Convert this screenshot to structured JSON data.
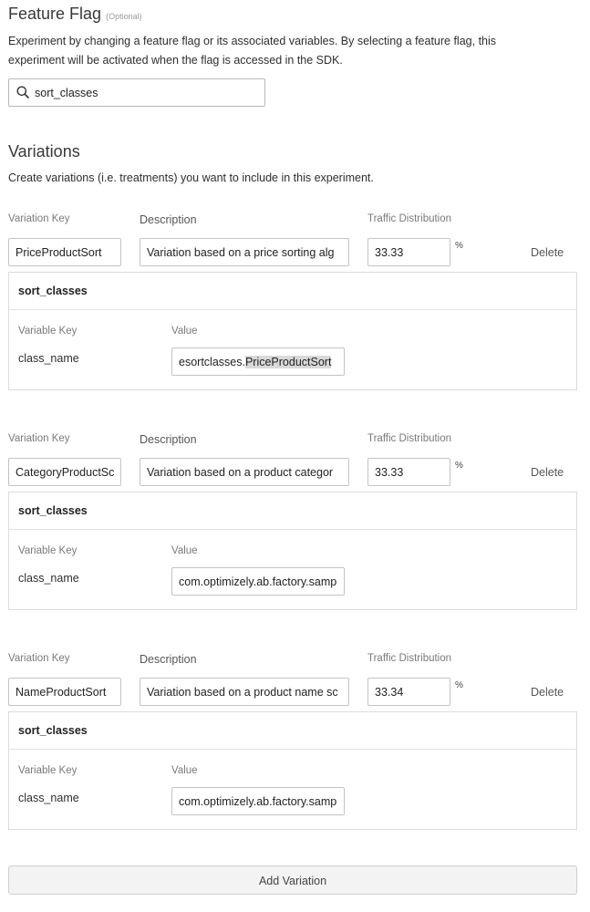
{
  "feature_flag": {
    "title": "Feature Flag",
    "optional": "(Optional)",
    "description_line1": "Experiment by changing a feature flag or its associated variables. By selecting a feature flag, this",
    "description_line2": "experiment will be activated when the flag is accessed in the SDK.",
    "search_value": "sort_classes"
  },
  "variations_section": {
    "title": "Variations",
    "description": "Create variations (i.e. treatments) you want to include in this experiment.",
    "col_variation_key": "Variation Key",
    "col_description": "Description",
    "col_traffic": "Traffic Distribution",
    "percent_symbol": "%",
    "delete_label": "Delete",
    "panel_var_key_label": "Variable Key",
    "panel_value_label": "Value",
    "add_variation_label": "Add Variation"
  },
  "variations": [
    {
      "key": "PriceProductSort",
      "description": "Variation based on a price sorting alg",
      "traffic": "33.33",
      "flag": "sort_classes",
      "variable_key": "class_name",
      "value_prefix": "esortclasses.",
      "value_selected": "PriceProductSort"
    },
    {
      "key": "CategoryProductSc",
      "description": "Variation based on a product categor",
      "traffic": "33.33",
      "flag": "sort_classes",
      "variable_key": "class_name",
      "value": "com.optimizely.ab.factory.samp"
    },
    {
      "key": "NameProductSort",
      "description": "Variation based on a product name sc",
      "traffic": "33.34",
      "flag": "sort_classes",
      "variable_key": "class_name",
      "value": "com.optimizely.ab.factory.samp"
    }
  ],
  "icons": {
    "search": "search-icon"
  }
}
